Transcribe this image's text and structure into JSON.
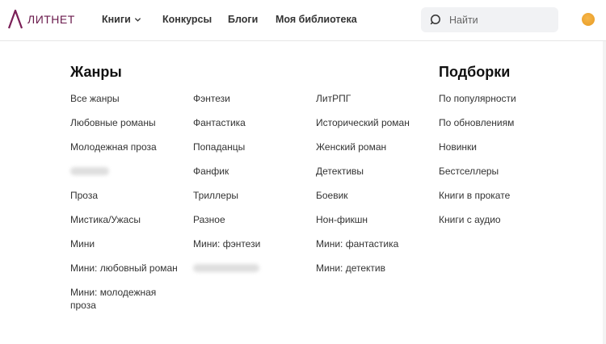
{
  "header": {
    "logo_text": "ЛИТНЕТ",
    "nav": {
      "books": "Книги",
      "contests": "Конкурсы",
      "blogs": "Блоги",
      "library": "Моя библиотека"
    },
    "search_placeholder": "Найти"
  },
  "menu": {
    "genres_heading": "Жанры",
    "collections_heading": "Подборки",
    "col1": [
      "Все жанры",
      "Любовные романы",
      "Молодежная проза",
      "",
      "Проза",
      "Мистика/Ужасы",
      "Мини",
      "Мини: любовный роман",
      "Мини: молодежная проза"
    ],
    "col2": [
      "Фэнтези",
      "Фантастика",
      "Попаданцы",
      "Фанфик",
      "Триллеры",
      "Разное",
      "Мини: фэнтези",
      ""
    ],
    "col3": [
      "ЛитРПГ",
      "Исторический роман",
      "Женский роман",
      "Детективы",
      "Боевик",
      "Нон-фикшн",
      "Мини: фантастика",
      "Мини: детектив"
    ],
    "col4": [
      "По популярности",
      "По обновлениям",
      "Новинки",
      "Бестселлеры",
      "Книги в прокате",
      "Книги с аудио"
    ]
  },
  "colors": {
    "brand": "#6a1a4c",
    "search_bg": "#f1f2f4",
    "avatar": "#e79a22"
  }
}
